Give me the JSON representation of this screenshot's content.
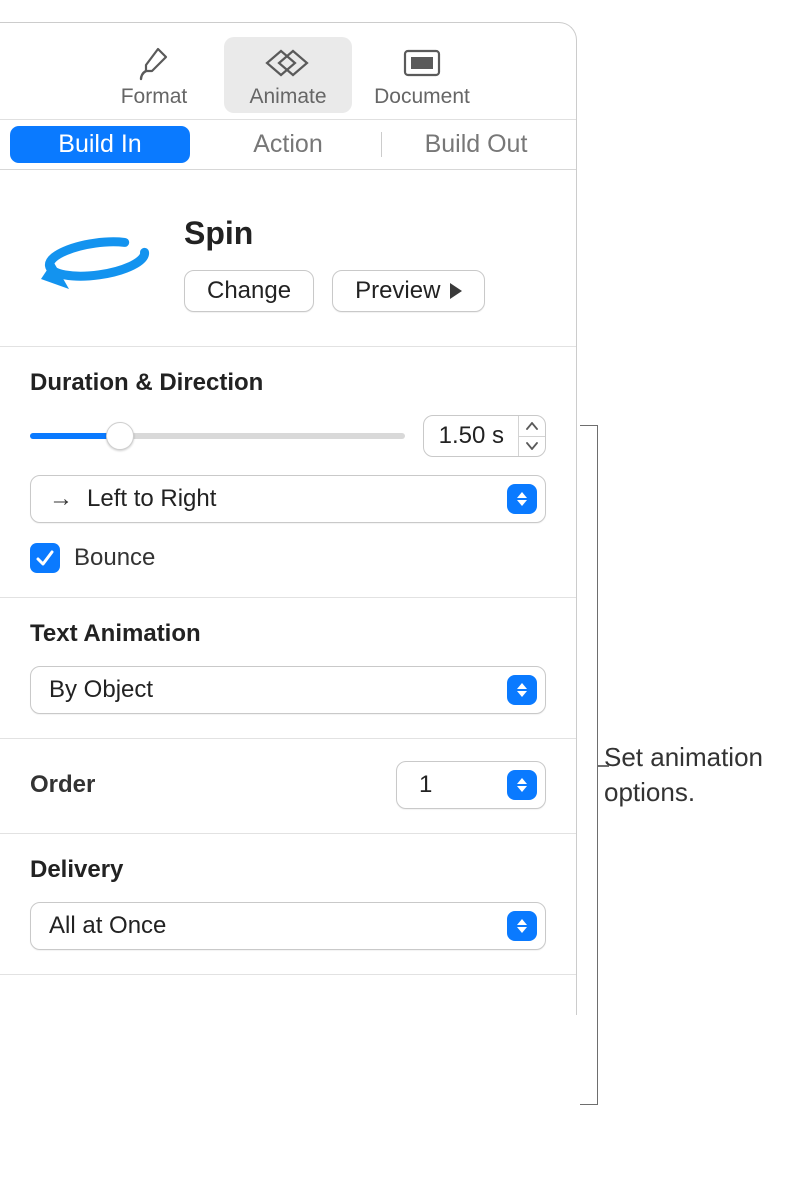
{
  "toolbar": {
    "format": "Format",
    "animate": "Animate",
    "document": "Document"
  },
  "subtabs": {
    "build_in": "Build In",
    "action": "Action",
    "build_out": "Build Out"
  },
  "header": {
    "title": "Spin",
    "change": "Change",
    "preview": "Preview"
  },
  "duration": {
    "title": "Duration & Direction",
    "value": "1.50 s",
    "direction": "Left to Right",
    "bounce": "Bounce"
  },
  "text_anim": {
    "title": "Text Animation",
    "value": "By Object"
  },
  "order": {
    "title": "Order",
    "value": "1"
  },
  "delivery": {
    "title": "Delivery",
    "value": "All at Once"
  },
  "callout": "Set animation options."
}
